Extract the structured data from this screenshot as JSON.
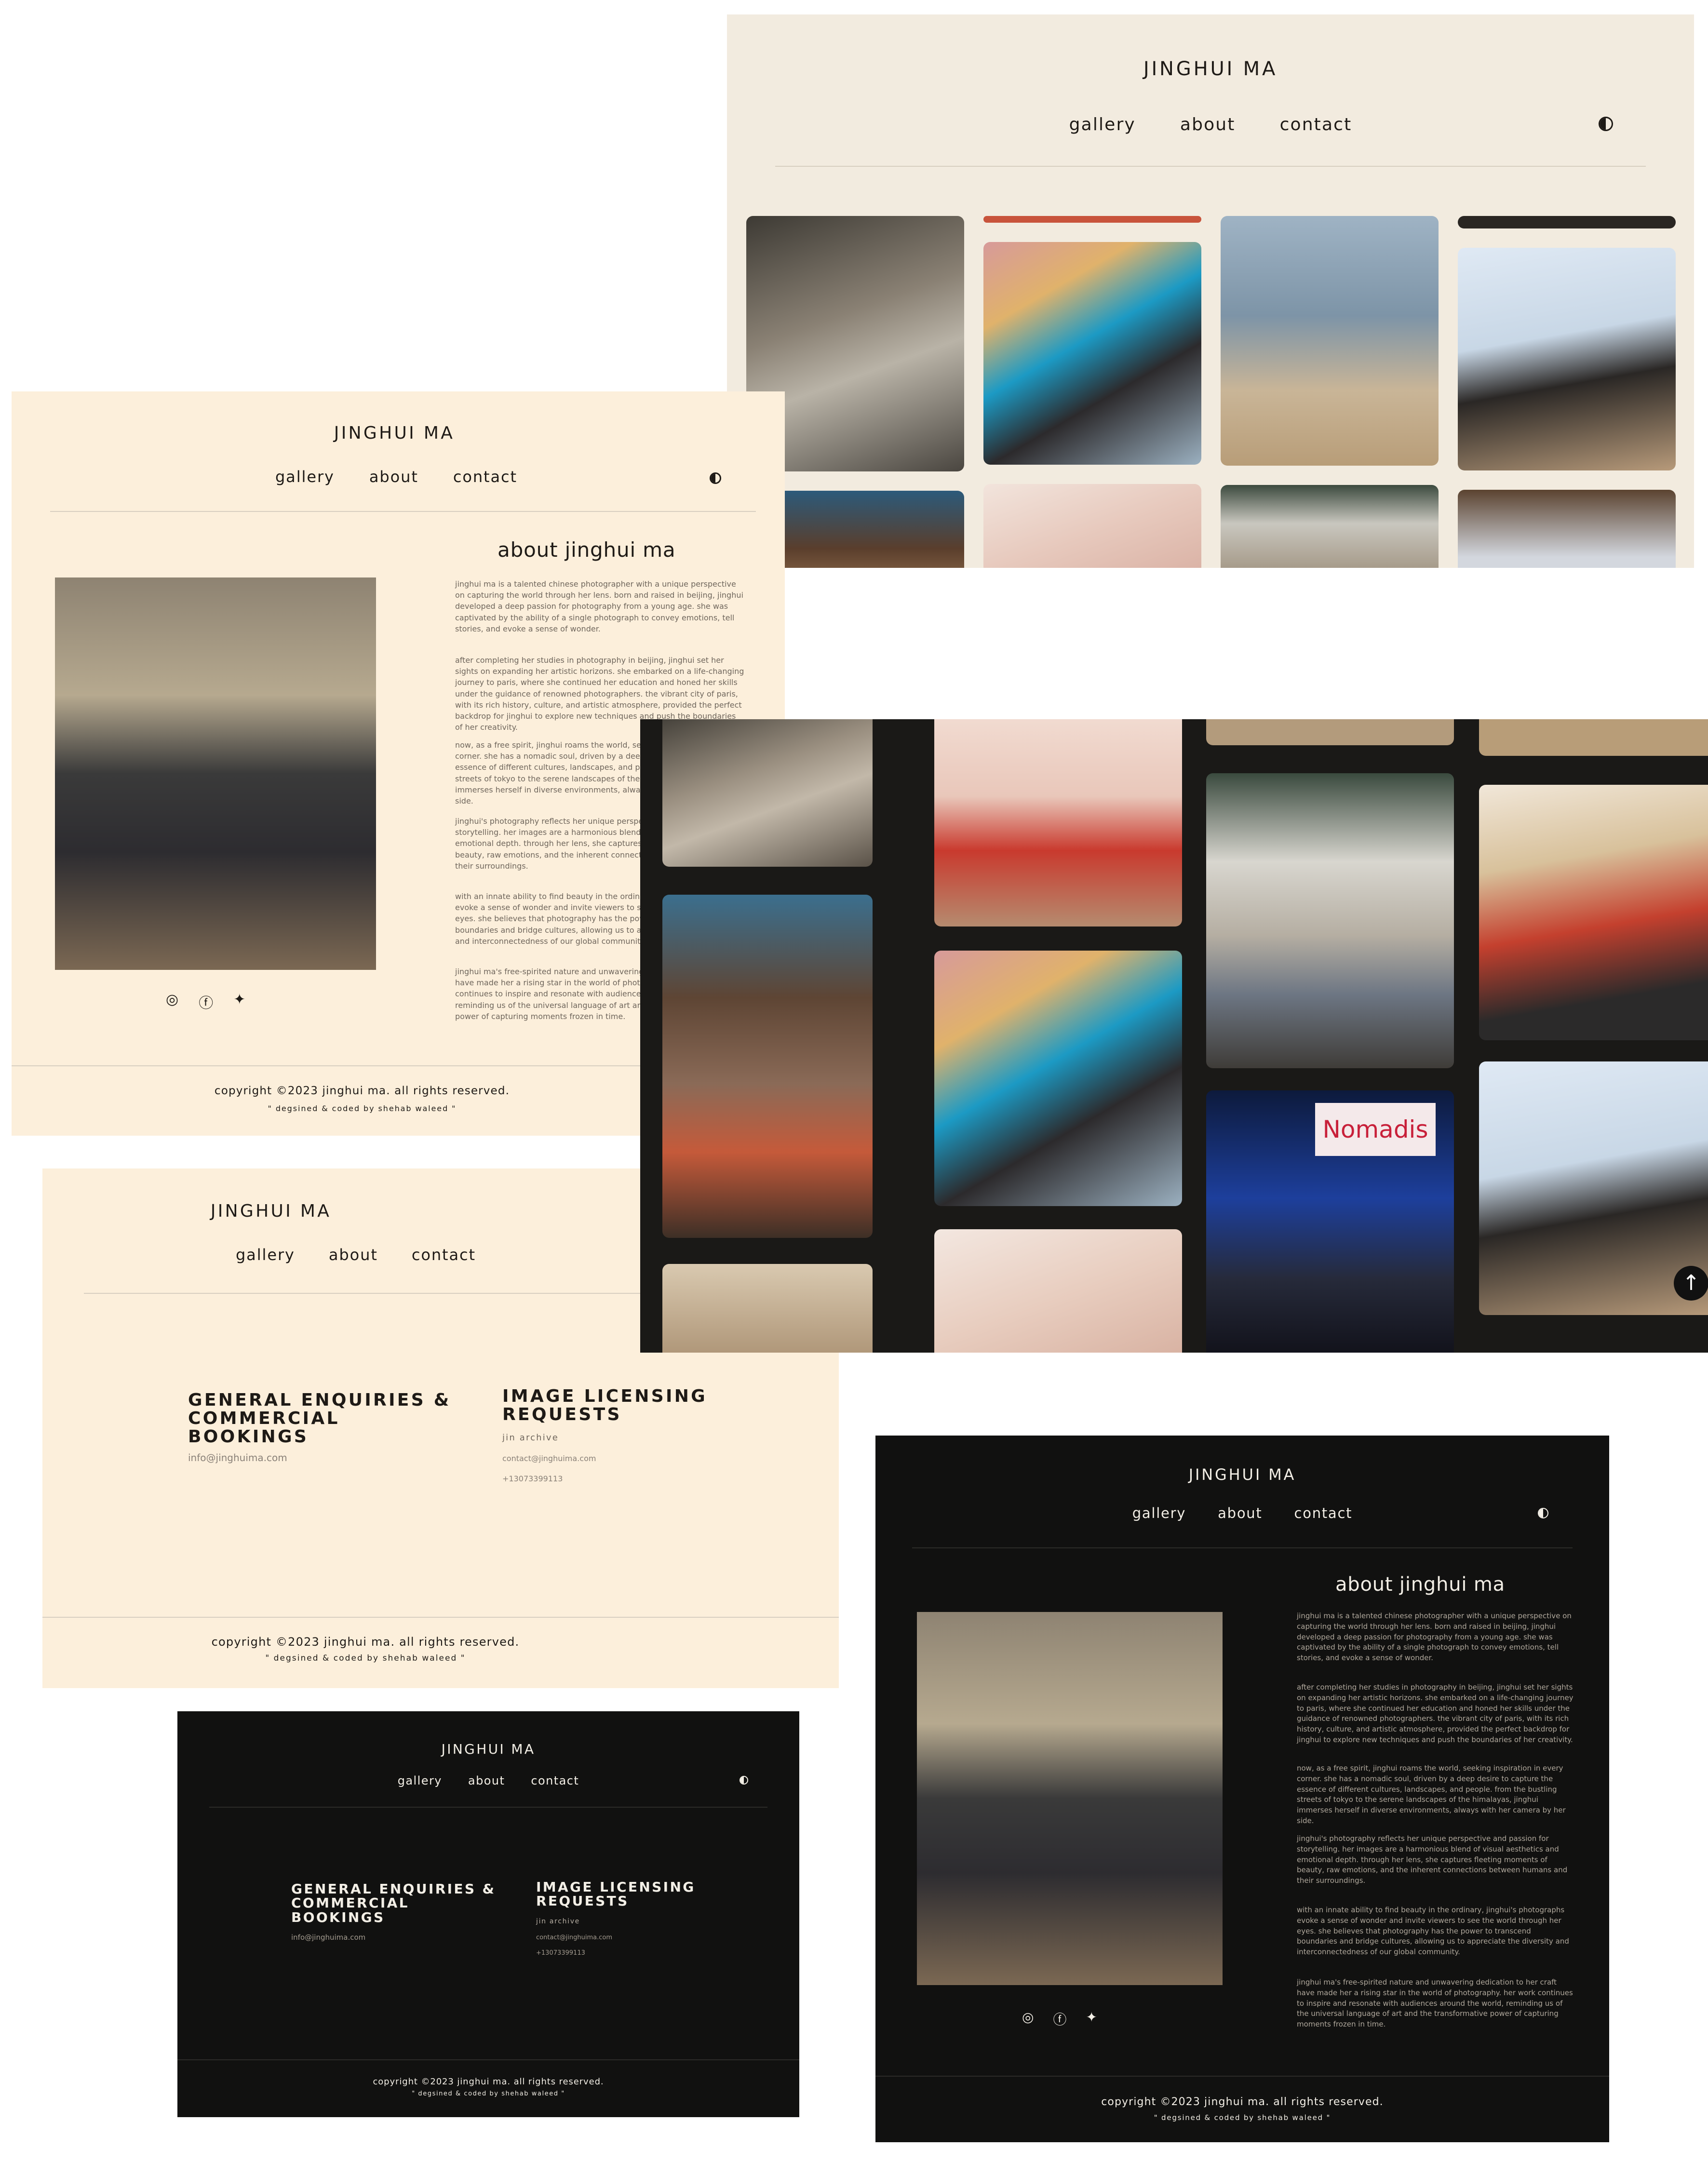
{
  "site": {
    "brand": "JINGHUI MA",
    "nav": [
      "gallery",
      "about",
      "contact"
    ],
    "theme_toggle_icon": "half-moon-icon",
    "copyright": "copyright ©2023 jinghui ma. all rights reserved.",
    "credit": "\" degsined & coded by shehab waleed \""
  },
  "about": {
    "title": "about jinghui ma",
    "paragraphs": [
      "jinghui ma is a talented chinese photographer with a unique perspective on capturing the world through her lens. born and raised in beijing, jinghui developed a deep passion for photography from a young age. she was captivated by the ability of a single photograph to convey emotions, tell stories, and evoke a sense of wonder.",
      "after completing her studies in photography in beijing, jinghui set her sights on expanding her artistic horizons. she embarked on a life-changing journey to paris, where she continued her education and honed her skills under the guidance of renowned photographers. the vibrant city of paris, with its rich history, culture, and artistic atmosphere, provided the perfect backdrop for jinghui to explore new techniques and push the boundaries of her creativity.",
      "now, as a free spirit, jinghui roams the world, seeking inspiration in every corner. she has a nomadic soul, driven by a deep desire to capture the essence of different cultures, landscapes, and people. from the bustling streets of tokyo to the serene landscapes of the himalayas, jinghui immerses herself in diverse environments, always with her camera by her side.",
      "jinghui's photography reflects her unique perspective and passion for storytelling. her images are a harmonious blend of visual aesthetics and emotional depth. through her lens, she captures fleeting moments of beauty, raw emotions, and the inherent connections between humans and their surroundings.",
      "with an innate ability to find beauty in the ordinary, jinghui's photographs evoke a sense of wonder and invite viewers to see the world through her eyes. she believes that photography has the power to transcend boundaries and bridge cultures, allowing us to appreciate the diversity and interconnectedness of our global community.",
      "jinghui ma's free-spirited nature and unwavering dedication to her craft have made her a rising star in the world of photography. her work continues to inspire and resonate with audiences around the world, reminding us of the universal language of art and the transformative power of capturing moments frozen in time."
    ],
    "social_icons": [
      "instagram-icon",
      "facebook-icon",
      "twitter-icon"
    ]
  },
  "contact": {
    "general_heading": "GENERAL ENQUIRIES & COMMERCIAL BOOKINGS",
    "general_email": "info@jinghuima.com",
    "licensing_heading": "IMAGE LICENSING REQUESTS",
    "licensing_sub": "jin archive",
    "licensing_email": "contact@jinghuima.com",
    "licensing_phone": "+13073399113"
  },
  "gallery": {
    "scroll_top_icon": "arrow-up-icon",
    "sign_text": "Nomadis"
  },
  "colors": {
    "cream": "#fcefdb",
    "beige": "#f2ebdf",
    "dark": "#111110",
    "ink": "#1e1a16"
  }
}
